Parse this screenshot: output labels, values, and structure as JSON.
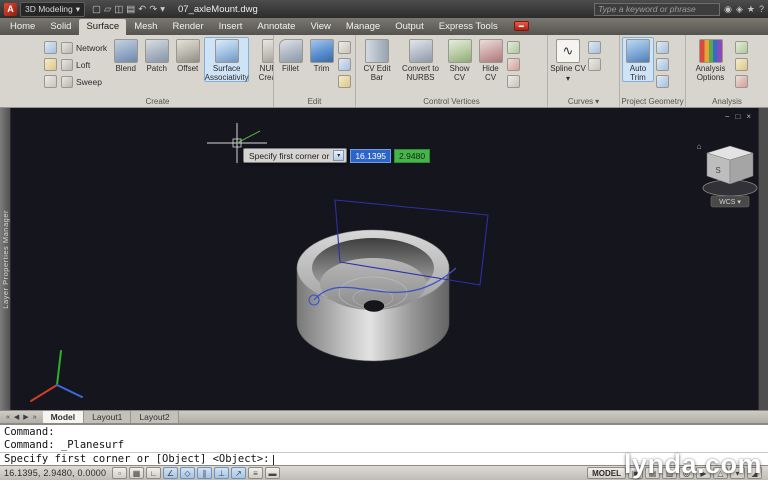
{
  "title_bar": {
    "app_initial": "A",
    "workspace": "3D Modeling",
    "filename": "07_axleMount.dwg",
    "search_placeholder": "Type a keyword or phrase"
  },
  "glyphs": {
    "dropdown": "▾",
    "new": "▢",
    "open": "▱",
    "save": "◫",
    "plot": "▤",
    "undo": "↶",
    "redo": "↷",
    "search": "◉",
    "comm": "◈",
    "star": "★",
    "help": "?",
    "record": "▬",
    "minimize": "−",
    "restore": "□",
    "close": "×",
    "spline": "∿"
  },
  "menu_tabs": [
    "Home",
    "Solid",
    "Surface",
    "Mesh",
    "Render",
    "Insert",
    "Annotate",
    "View",
    "Manage",
    "Output",
    "Express Tools"
  ],
  "ribbon": {
    "create": {
      "label": "Create",
      "items": [
        "Network",
        "Loft",
        "Sweep",
        "Blend",
        "Patch",
        "Offset",
        "Surface Associativity",
        "NURBS Creation"
      ]
    },
    "edit": {
      "label": "Edit",
      "items": [
        "Fillet",
        "Trim"
      ]
    },
    "cv": {
      "label": "Control Vertices",
      "items": [
        "CV Edit Bar",
        "Convert to NURBS",
        "Show CV",
        "Hide CV"
      ]
    },
    "curves": {
      "label": "Curves",
      "items": [
        "Spline CV"
      ]
    },
    "proj": {
      "label": "Project Geometry",
      "items": [
        "Auto Trim"
      ]
    },
    "analysis": {
      "label": "Analysis",
      "items": [
        "Analysis Options"
      ]
    }
  },
  "palette": {
    "title": "Layer Properties Manager"
  },
  "viewport": {
    "tooltip": {
      "prompt": "Specify first corner or",
      "x_value": "16.1395",
      "y_value": "2.9480"
    },
    "viewcube": {
      "face": "S",
      "wcs": "WCS ▾",
      "home": "⌂"
    }
  },
  "layout": {
    "nav": [
      "«",
      "◀",
      "▶",
      "»"
    ],
    "tabs": [
      "Model",
      "Layout1",
      "Layout2"
    ]
  },
  "command": {
    "history": [
      "Command:",
      "Command: _Planesurf"
    ],
    "prompt": "Specify first corner or [Object] <Object>:"
  },
  "status_bar": {
    "coords": "16.1395, 2.9480, 0.0000",
    "model_label": "MODEL",
    "toggle_glyphs": [
      "▫",
      "▦",
      "∟",
      "∠",
      "◇",
      "∥",
      "⊥",
      "↗",
      "≡",
      "▬"
    ],
    "right_glyphs": [
      "▣",
      "▤",
      "▥",
      "◎",
      "▶",
      "△",
      "▾",
      "◢"
    ]
  },
  "watermark": "lynda.com",
  "colors": {
    "highlight_blue": "#2d64c8",
    "value_green": "#46b44b",
    "viewport_bg": "#15151d"
  }
}
